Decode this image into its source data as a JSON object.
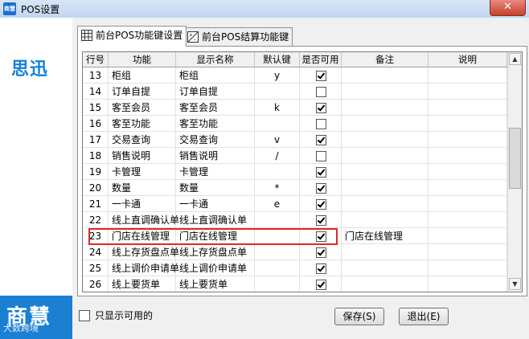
{
  "window": {
    "title": "POS设置",
    "close_glyph": "✕",
    "app_icon_text": "商慧"
  },
  "branding": {
    "top_logo": "思迅",
    "bottom_logo": "商慧",
    "watermark": "大数跨境"
  },
  "tabs": [
    {
      "label": "前台POS功能键设置",
      "icon": "grid-icon",
      "active": true
    },
    {
      "label": "前台POS结算功能键",
      "icon": "plus-minus-icon",
      "active": false
    }
  ],
  "grid": {
    "columns": [
      "行号",
      "功能",
      "显示名称",
      "默认键",
      "是否可用",
      "备注",
      "说明"
    ],
    "rows": [
      {
        "no": "13",
        "func": "柜组",
        "display": "柜组",
        "key": "y",
        "enabled": true,
        "remark": ""
      },
      {
        "no": "14",
        "func": "订单自提",
        "display": "订单自提",
        "key": "",
        "enabled": false,
        "remark": ""
      },
      {
        "no": "15",
        "func": "客至会员",
        "display": "客至会员",
        "key": "k",
        "enabled": true,
        "remark": ""
      },
      {
        "no": "16",
        "func": "客至功能",
        "display": "客至功能",
        "key": "",
        "enabled": false,
        "remark": ""
      },
      {
        "no": "17",
        "func": "交易查询",
        "display": "交易查询",
        "key": "v",
        "enabled": true,
        "remark": ""
      },
      {
        "no": "18",
        "func": "销售说明",
        "display": "销售说明",
        "key": "/",
        "enabled": false,
        "remark": ""
      },
      {
        "no": "19",
        "func": "卡管理",
        "display": "卡管理",
        "key": "",
        "enabled": true,
        "remark": ""
      },
      {
        "no": "20",
        "func": "数量",
        "display": "数量",
        "key": "*",
        "enabled": true,
        "remark": ""
      },
      {
        "no": "21",
        "func": "一卡通",
        "display": "一卡通",
        "key": "e",
        "enabled": true,
        "remark": ""
      },
      {
        "no": "22",
        "func": "线上直调确认单",
        "display": "线上直调确认单",
        "key": "",
        "enabled": true,
        "remark": ""
      },
      {
        "no": "23",
        "func": "门店在线管理",
        "display": "门店在线管理",
        "key": "",
        "enabled": true,
        "remark": "门店在线管理"
      },
      {
        "no": "24",
        "func": "线上存货盘点单",
        "display": "线上存货盘点单",
        "key": "",
        "enabled": true,
        "remark": ""
      },
      {
        "no": "25",
        "func": "线上调价申请单",
        "display": "线上调价申请单",
        "key": "",
        "enabled": true,
        "remark": ""
      },
      {
        "no": "26",
        "func": "线上要货单",
        "display": "线上要货单",
        "key": "",
        "enabled": true,
        "remark": ""
      }
    ],
    "highlighted_row": "21"
  },
  "footer": {
    "only_available_label": "只显示可用的",
    "only_available_checked": false,
    "save_label": "保存(S)",
    "exit_label": "退出(E)"
  },
  "colors": {
    "highlight": "#e0262a",
    "brand_blue": "#1b7fd4"
  }
}
